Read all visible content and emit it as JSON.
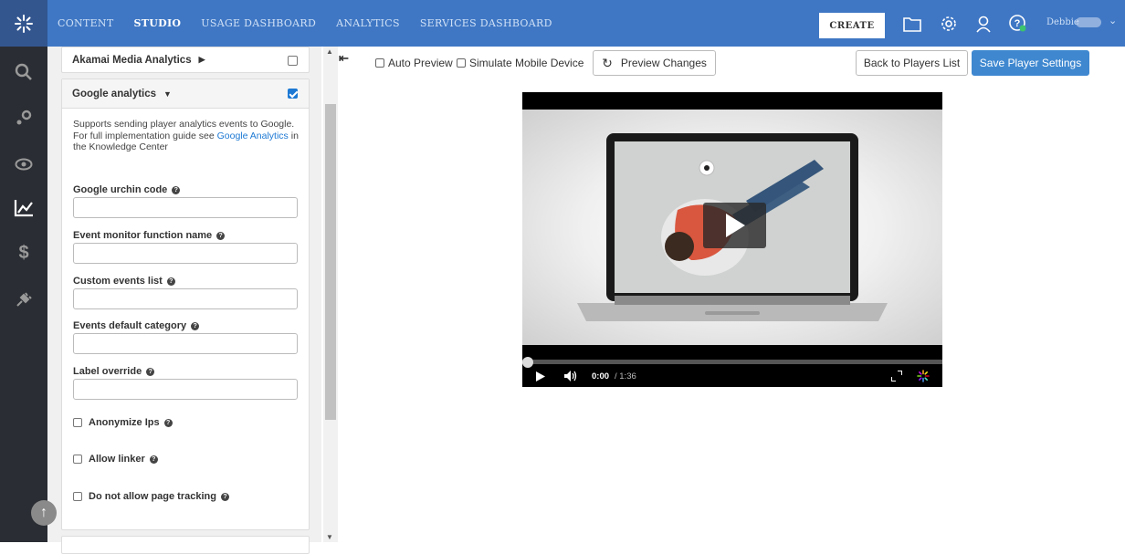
{
  "topbar": {
    "nav": [
      {
        "label": "CONTENT",
        "active": false
      },
      {
        "label": "STUDIO",
        "active": true
      },
      {
        "label": "USAGE DASHBOARD",
        "active": false
      },
      {
        "label": "ANALYTICS",
        "active": false
      },
      {
        "label": "SERVICES DASHBOARD",
        "active": false
      }
    ],
    "create_label": "CREATE",
    "user_name": "Debbie",
    "icons": [
      "kaltura-logo-icon",
      "folder-icon",
      "gear-icon",
      "user-icon",
      "help-icon",
      "chevron-down-icon"
    ]
  },
  "leftnav": {
    "icons": [
      "search-icon",
      "settings-gears-icon",
      "eye-icon",
      "analytics-chart-icon",
      "dollar-icon",
      "plugin-icon",
      "scroll-up-icon"
    ]
  },
  "panel": {
    "akamai": {
      "label": "Akamai Media Analytics",
      "caret": "▶",
      "checked": false
    },
    "google": {
      "label": "Google analytics",
      "caret": "▼",
      "checked": true,
      "desc_line1": "Supports sending player analytics events to Google.",
      "desc_line2_prefix": "For full implementation guide see ",
      "desc_link": "Google Analytics",
      "desc_line2_suffix": " in the Knowledge Center",
      "fields": {
        "urchin": {
          "label": "Google urchin code",
          "value": ""
        },
        "event_monitor": {
          "label": "Event monitor function name",
          "value": ""
        },
        "custom_events": {
          "label": "Custom events list",
          "value": ""
        },
        "default_category": {
          "label": "Events default category",
          "value": ""
        },
        "label_override": {
          "label": "Label override",
          "value": ""
        }
      },
      "checkboxes": {
        "anonymize": {
          "label": "Anonymize Ips",
          "checked": false
        },
        "allow_linker": {
          "label": "Allow linker",
          "checked": false
        },
        "no_page_tracking": {
          "label": "Do not allow page tracking",
          "checked": false
        }
      }
    }
  },
  "toolbar": {
    "auto_preview": "Auto Preview",
    "simulate_mobile": "Simulate Mobile Device",
    "preview_changes": "Preview Changes",
    "back_to_players": "Back to Players List",
    "save_settings": "Save Player Settings"
  },
  "player": {
    "current_time": "0:00",
    "duration": "/ 1:36",
    "progress": 0
  },
  "colors": {
    "topbar": "#3f77c4",
    "leftnav": "#2a2d33",
    "primary_button": "#3f88d0",
    "link": "#1d79d4"
  }
}
